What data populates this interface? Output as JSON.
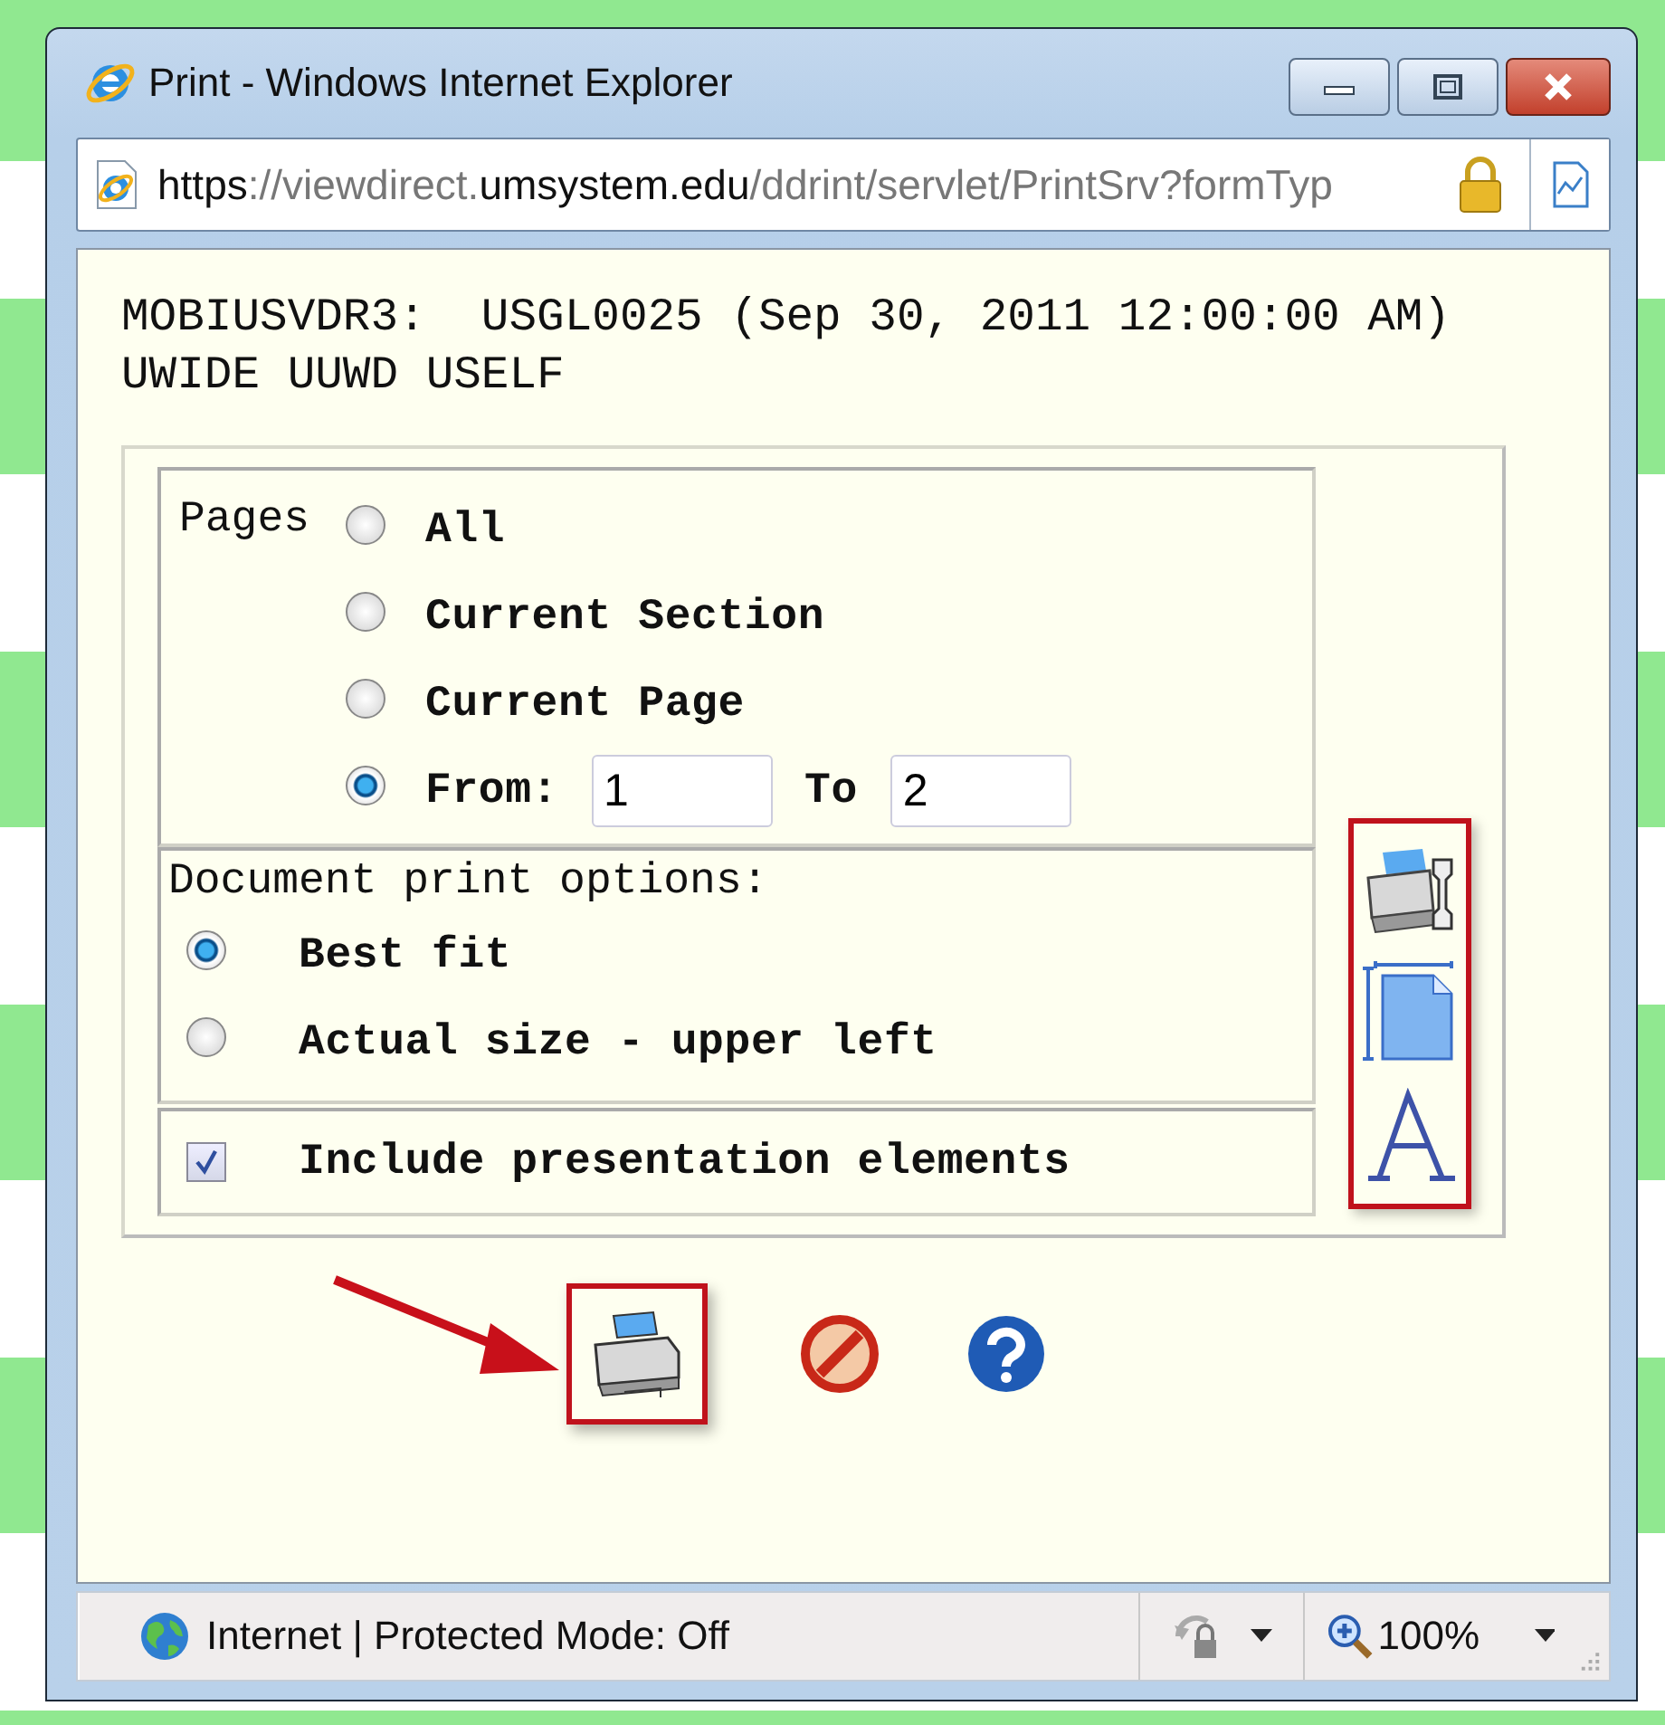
{
  "window": {
    "title": "Print - Windows Internet Explorer"
  },
  "address_bar": {
    "url_parts": [
      {
        "text": "https",
        "emphasis": true
      },
      {
        "text": "://viewdirect.",
        "emphasis": false
      },
      {
        "text": "umsystem.edu",
        "emphasis": true
      },
      {
        "text": "/ddrint/servlet/PrintSrv?formTyp",
        "emphasis": false
      }
    ]
  },
  "report": {
    "lines": [
      "MOBIUSVDR3:  USGL0025 (Sep 30, 2011 12:00:00 AM)",
      "UWIDE UUWD USELF"
    ]
  },
  "pages": {
    "label": "Pages",
    "options": [
      {
        "label": "All",
        "selected": false,
        "kind": "plain"
      },
      {
        "label": "Current Section",
        "selected": false,
        "kind": "plain"
      },
      {
        "label": "Current Page",
        "selected": false,
        "kind": "plain"
      },
      {
        "label": "From:",
        "selected": true,
        "kind": "range"
      }
    ],
    "from": "1",
    "to_label": "To",
    "to": "2"
  },
  "document_options": {
    "title": "Document print options:",
    "options": [
      {
        "label": "Best fit",
        "selected": true
      },
      {
        "label": "Actual size - upper left",
        "selected": false
      }
    ]
  },
  "include_presentation": {
    "label": "Include presentation elements",
    "checked": true
  },
  "status_bar": {
    "zone": "Internet | Protected Mode: Off",
    "zoom": "100%"
  }
}
